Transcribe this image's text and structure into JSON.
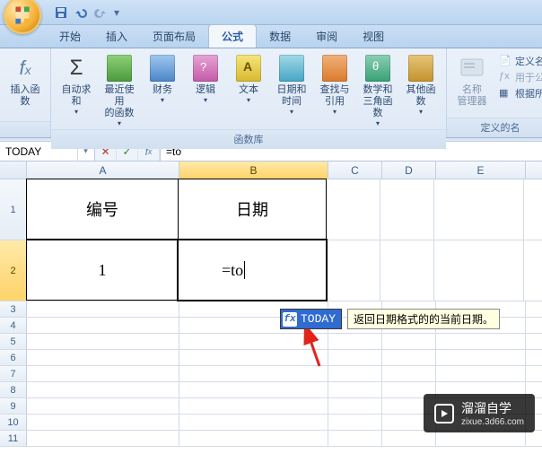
{
  "qat": {
    "save": "save",
    "undo": "undo",
    "redo": "redo"
  },
  "tabs": {
    "home": "开始",
    "insert": "插入",
    "layout": "页面布局",
    "formulas": "公式",
    "data": "数据",
    "review": "审阅",
    "view": "视图"
  },
  "ribbon": {
    "insert_fn": "插入函数",
    "autosum": "自动求和",
    "recent": "最近使用\n的函数",
    "financial": "财务",
    "logical": "逻辑",
    "text": "文本",
    "datetime": "日期和\n时间",
    "lookup": "查找与\n引用",
    "math": "数学和\n三角函数",
    "more": "其他函数",
    "name_mgr": "名称\n管理器",
    "define_name": "定义名",
    "use_in_formula": "用于公",
    "create_from_sel": "根据所",
    "group_fnlib": "函数库",
    "group_names": "定义的名"
  },
  "formulaBar": {
    "nameBox": "TODAY",
    "formula": "=to"
  },
  "headers": {
    "A": "A",
    "B": "B",
    "C": "C",
    "D": "D",
    "E": "E"
  },
  "cells": {
    "A1": "编号",
    "B1": "日期",
    "A2": "1",
    "B2": "=to"
  },
  "autocomplete": {
    "item": "TODAY",
    "desc": "返回日期格式的的当前日期。"
  },
  "watermark": {
    "brand": "溜溜自学",
    "url": "zixue.3d66.com"
  }
}
